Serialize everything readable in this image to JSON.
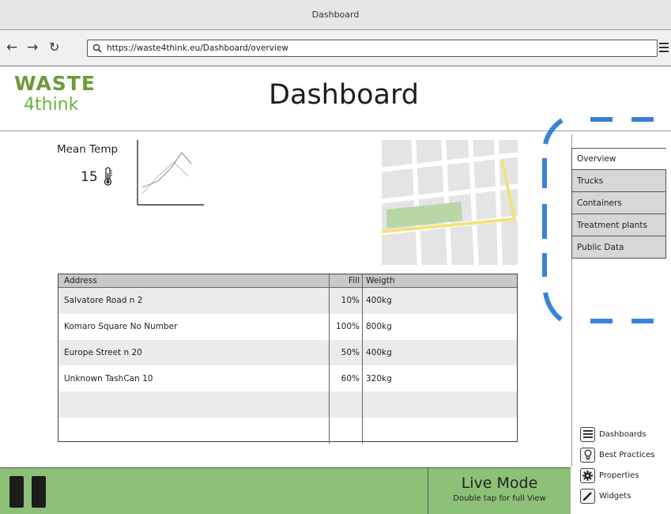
{
  "browser": {
    "window_title": "Dashboard",
    "url": "https://waste4think.eu/Dashboard/overview"
  },
  "logo": {
    "top": "WASTE",
    "bottom": "4think"
  },
  "page_title": "Dashboard",
  "widget": {
    "label": "Mean Temp",
    "value": "15",
    "icon": "thermometer-icon"
  },
  "table": {
    "headers": [
      "Address",
      "Fill",
      "Weigth"
    ],
    "rows": [
      [
        "Salvatore Road n 2",
        "10%",
        " 400kg"
      ],
      [
        "Komaro Square  No Number",
        "100%",
        "800kg"
      ],
      [
        "Europe Street n 20",
        "50%",
        "400kg"
      ],
      [
        "Unknown TashCan 10",
        "60%",
        "320kg"
      ]
    ]
  },
  "tabs": [
    {
      "label": "Overview",
      "active": true
    },
    {
      "label": "Trucks",
      "active": false
    },
    {
      "label": "Containers",
      "active": false
    },
    {
      "label": "Treatment plants",
      "active": false
    },
    {
      "label": "Public Data",
      "active": false
    }
  ],
  "side_menu": [
    {
      "label": "Dashboards",
      "icon": "list-icon"
    },
    {
      "label": "Best Practices",
      "icon": "lightbulb-icon"
    },
    {
      "label": "Properties",
      "icon": "gear-icon"
    },
    {
      "label": "Widgets",
      "icon": "pencil-icon"
    }
  ],
  "footer": {
    "live_title": "Live Mode",
    "live_sub": "Double tap for full View"
  },
  "colors": {
    "footer_bg": "#8dc178",
    "annotation_blue": "#3b82d6",
    "map_route": "#f3e17a",
    "map_park": "#b9d6a6"
  }
}
